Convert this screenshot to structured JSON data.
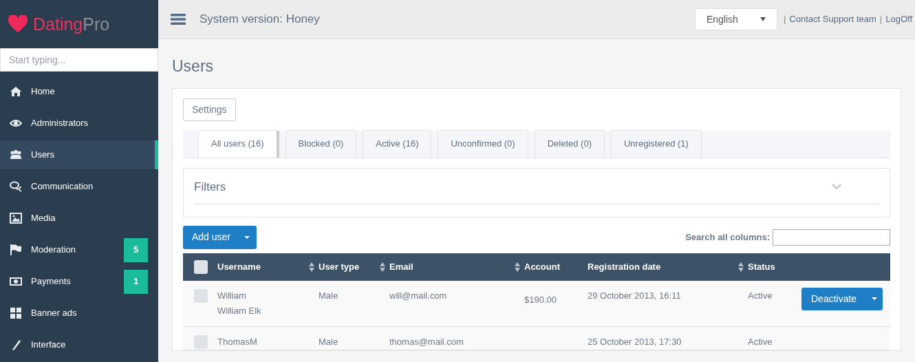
{
  "logo": {
    "brand": "Dating",
    "suffix": "Pro"
  },
  "sidebar": {
    "search_placeholder": "Start typing...",
    "items": [
      {
        "label": "Home",
        "selected": false
      },
      {
        "label": "Administrators",
        "selected": false
      },
      {
        "label": "Users",
        "selected": true
      },
      {
        "label": "Communication",
        "selected": false
      },
      {
        "label": "Media",
        "selected": false
      },
      {
        "label": "Moderation",
        "selected": false,
        "badge": "5"
      },
      {
        "label": "Payments",
        "selected": false,
        "badge": "1"
      },
      {
        "label": "Banner ads",
        "selected": false
      },
      {
        "label": "Interface",
        "selected": false
      }
    ]
  },
  "topbar": {
    "title": "System version: Honey",
    "language": "English",
    "links": [
      {
        "separator": "|",
        "label": "Contact Support team"
      },
      {
        "separator": "|",
        "label": "LogOff"
      }
    ]
  },
  "page_title": "Users",
  "settings_button": "Settings",
  "tabs": [
    {
      "label": "All users (16)",
      "selected": true
    },
    {
      "label": "Blocked (0)",
      "selected": false
    },
    {
      "label": "Active (16)",
      "selected": false
    },
    {
      "label": "Unconfirmed (0)",
      "selected": false
    },
    {
      "label": "Deleted (0)",
      "selected": false
    },
    {
      "label": "Unregistered (1)",
      "selected": false
    }
  ],
  "filters": {
    "title": "Filters",
    "expanded": false
  },
  "add_user_button": "Add user",
  "search_label": "Search all columns:",
  "table": {
    "all_selected": false,
    "columns": [
      {
        "label": "Username",
        "sortable": true
      },
      {
        "label": "User type",
        "sortable": true
      },
      {
        "label": "Email",
        "sortable": true
      },
      {
        "label": "Account",
        "sortable": false
      },
      {
        "label": "Registration date",
        "sortable": true
      },
      {
        "label": "Status",
        "sortable": false
      }
    ],
    "rows": [
      {
        "checked": false,
        "username": "William",
        "full_name": "William Elk",
        "user_type": "Male",
        "email": "will@mail.com",
        "account": "$190.00",
        "registration_date": "29 October 2013, 16:11",
        "status": "Active",
        "action": "Deactivate"
      },
      {
        "checked": false,
        "username": "ThomasM",
        "user_type": "Male",
        "email": "thomas@mail.com",
        "registration_date": "25 October 2013, 17:30",
        "status": "Active"
      }
    ]
  }
}
